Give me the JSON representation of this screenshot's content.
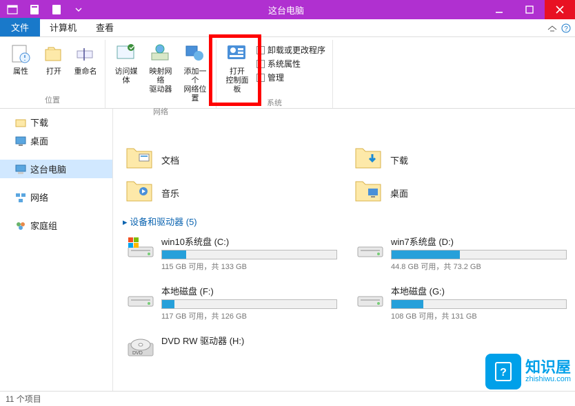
{
  "title": "这台电脑",
  "tabs": {
    "file": "文件",
    "computer": "计算机",
    "view": "查看"
  },
  "ribbon": {
    "location": {
      "name": "位置",
      "items": [
        "属性",
        "打开",
        "重命名"
      ]
    },
    "network": {
      "name": "网络",
      "items": [
        "访问媒体",
        "映射网络\n驱动器",
        "添加一个\n网络位置"
      ]
    },
    "system": {
      "name": "系统",
      "open_cp": "打开\n控制面板",
      "links": [
        "卸载或更改程序",
        "系统属性",
        "管理"
      ]
    }
  },
  "sidebar": {
    "downloads": "下载",
    "desktop": "桌面",
    "this_pc": "这台电脑",
    "network": "网络",
    "homegroup": "家庭组"
  },
  "folders": [
    {
      "name": "文档"
    },
    {
      "name": "下载"
    },
    {
      "name": "音乐"
    },
    {
      "name": "桌面"
    }
  ],
  "section_drives": "设备和驱动器 (5)",
  "drives": [
    {
      "name": "win10系统盘 (C:)",
      "free": "115 GB 可用，共 133 GB",
      "pct": 14
    },
    {
      "name": "win7系统盘 (D:)",
      "free": "44.8 GB 可用，共 73.2 GB",
      "pct": 39
    },
    {
      "name": "本地磁盘 (F:)",
      "free": "117 GB 可用，共 126 GB",
      "pct": 7
    },
    {
      "name": "本地磁盘 (G:)",
      "free": "108 GB 可用，共 131 GB",
      "pct": 18
    },
    {
      "name": "DVD RW 驱动器 (H:)",
      "free": "",
      "pct": null
    }
  ],
  "status": "11 个项目",
  "watermark": {
    "brand": "知识屋",
    "url": "zhishiwu.com"
  }
}
